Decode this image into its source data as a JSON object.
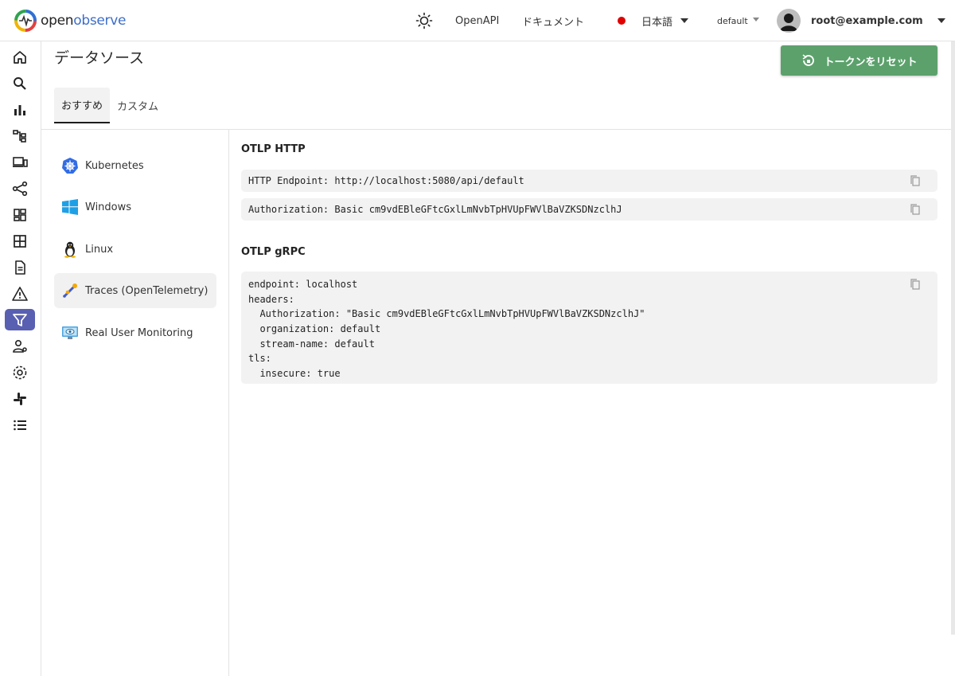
{
  "app": {
    "logo_part1": "open",
    "logo_part2": "observe"
  },
  "header": {
    "openapi": "OpenAPI",
    "docs": "ドキュメント",
    "language": "日本語",
    "org": "default",
    "user": "root@example.com",
    "icons": [
      "sun-icon",
      "caret-down-icon",
      "avatar-icon"
    ],
    "colors": {
      "status_dot": "#e00000"
    }
  },
  "sidebar": {
    "items": [
      {
        "name": "home-icon"
      },
      {
        "name": "search-icon"
      },
      {
        "name": "metrics-icon"
      },
      {
        "name": "traces-icon"
      },
      {
        "name": "rum-icon"
      },
      {
        "name": "pipelines-icon"
      },
      {
        "name": "dashboards-icon"
      },
      {
        "name": "streams-icon"
      },
      {
        "name": "reports-icon"
      },
      {
        "name": "alerts-icon"
      },
      {
        "name": "ingestion-icon",
        "active": true
      },
      {
        "name": "iam-icon"
      },
      {
        "name": "settings-icon"
      },
      {
        "name": "slack-icon"
      },
      {
        "name": "about-icon"
      }
    ],
    "active_color": "#5960b2"
  },
  "page": {
    "title": "データソース",
    "reset_button": "トークンをリセット",
    "reset_button_color": "#5ca16c",
    "tabs": [
      {
        "label": "おすすめ",
        "active": true
      },
      {
        "label": "カスタム",
        "active": false
      }
    ]
  },
  "sources": [
    {
      "label": "Kubernetes",
      "icon": "kubernetes-icon"
    },
    {
      "label": "Windows",
      "icon": "windows-icon"
    },
    {
      "label": "Linux",
      "icon": "linux-icon"
    },
    {
      "label": "Traces (OpenTelemetry)",
      "icon": "opentelemetry-icon",
      "active": true
    },
    {
      "label": "Real User Monitoring",
      "icon": "rum-monitor-icon"
    }
  ],
  "content": {
    "otlp_http_title": "OTLP HTTP",
    "http_endpoint": "HTTP Endpoint: http://localhost:5080/api/default",
    "authorization": "Authorization: Basic cm9vdEBleGFtcGxlLmNvbTpHVUpFWVlBaVZKSDNzclhJ",
    "otlp_grpc_title": "OTLP gRPC",
    "grpc_lines": [
      "endpoint: localhost",
      "headers:",
      "  Authorization: \"Basic cm9vdEBleGFtcGxlLmNvbTpHVUpFWVlBaVZKSDNzclhJ\"",
      "  organization: default",
      "  stream-name: default",
      "tls:",
      "  insecure: true"
    ]
  }
}
